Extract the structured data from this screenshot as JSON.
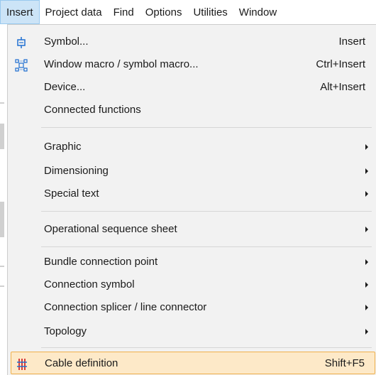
{
  "menubar": {
    "items": [
      {
        "label": "Insert",
        "active": true
      },
      {
        "label": "Project data"
      },
      {
        "label": "Find"
      },
      {
        "label": "Options"
      },
      {
        "label": "Utilities"
      },
      {
        "label": "Window"
      }
    ]
  },
  "menu": {
    "symbol": {
      "label": "Symbol...",
      "shortcut": "Insert",
      "icon": "symbol-icon"
    },
    "window_macro": {
      "label": "Window macro / symbol macro...",
      "shortcut": "Ctrl+Insert",
      "icon": "macro-icon"
    },
    "device": {
      "label": "Device...",
      "shortcut": "Alt+Insert"
    },
    "connected_functions": {
      "label": "Connected functions"
    },
    "graphic": {
      "label": "Graphic"
    },
    "dimensioning": {
      "label": "Dimensioning"
    },
    "special_text": {
      "label": "Special text"
    },
    "operational_sequence": {
      "label": "Operational sequence sheet"
    },
    "bundle_connection": {
      "label": "Bundle connection point"
    },
    "connection_symbol": {
      "label": "Connection symbol"
    },
    "connection_splicer": {
      "label": "Connection splicer / line connector"
    },
    "topology": {
      "label": "Topology"
    },
    "cable_definition": {
      "label": "Cable definition",
      "shortcut": "Shift+F5",
      "icon": "cable-icon"
    }
  },
  "colors": {
    "menu_bg": "#f2f2f2",
    "active_menubar": "#cce4f7",
    "highlight_bg": "#fde9c8",
    "highlight_border": "#f0b04b",
    "icon_blue": "#1f6fd1",
    "icon_red": "#d83b3b"
  }
}
